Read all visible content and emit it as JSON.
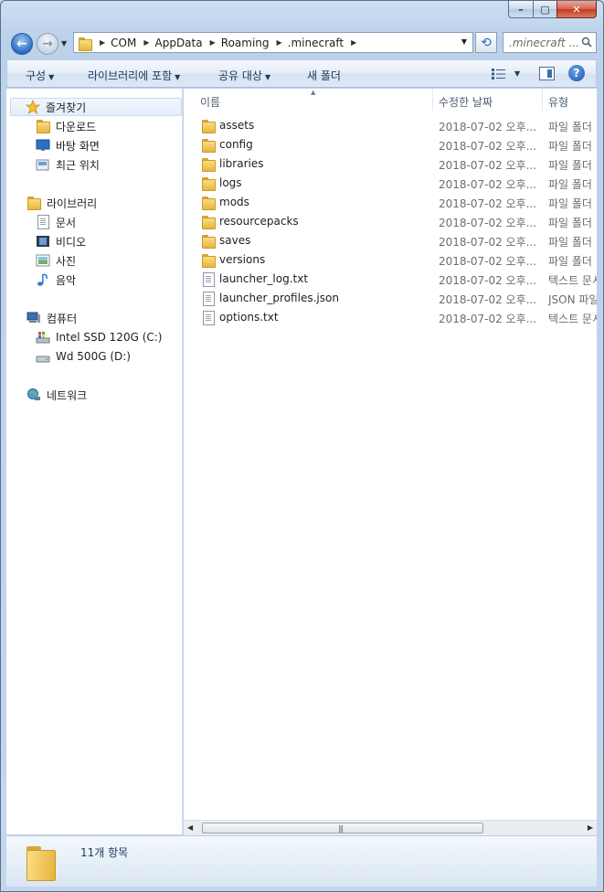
{
  "window": {
    "caption": {
      "minimize": "–",
      "maximize": "▢",
      "close": "✕"
    }
  },
  "address": {
    "crumbs": [
      "COM",
      "AppData",
      "Roaming",
      ".minecraft"
    ],
    "search_placeholder": ".minecraft ..."
  },
  "toolbar": {
    "organize": "구성",
    "include_library": "라이브러리에 포함",
    "share_with": "공유 대상",
    "new_folder": "새 폴더",
    "help": "?"
  },
  "nav": {
    "favorites": "즐겨찾기",
    "downloads": "다운로드",
    "desktop": "바탕 화면",
    "recent": "최근 위치",
    "libraries": "라이브러리",
    "documents": "문서",
    "videos": "비디오",
    "pictures": "사진",
    "music": "음악",
    "computer": "컴퓨터",
    "drive_c": "Intel SSD 120G (C:)",
    "drive_d": "Wd 500G (D:)",
    "network": "네트워크"
  },
  "columns": {
    "name": "이름",
    "date": "수정한 날짜",
    "type": "유형"
  },
  "files": [
    {
      "name": "assets",
      "date": "2018-07-02 오후...",
      "type": "파일 폴더",
      "kind": "folder"
    },
    {
      "name": "config",
      "date": "2018-07-02 오후...",
      "type": "파일 폴더",
      "kind": "folder"
    },
    {
      "name": "libraries",
      "date": "2018-07-02 오후...",
      "type": "파일 폴더",
      "kind": "folder"
    },
    {
      "name": "logs",
      "date": "2018-07-02 오후...",
      "type": "파일 폴더",
      "kind": "folder"
    },
    {
      "name": "mods",
      "date": "2018-07-02 오후...",
      "type": "파일 폴더",
      "kind": "folder"
    },
    {
      "name": "resourcepacks",
      "date": "2018-07-02 오후...",
      "type": "파일 폴더",
      "kind": "folder"
    },
    {
      "name": "saves",
      "date": "2018-07-02 오후...",
      "type": "파일 폴더",
      "kind": "folder"
    },
    {
      "name": "versions",
      "date": "2018-07-02 오후...",
      "type": "파일 폴더",
      "kind": "folder"
    },
    {
      "name": "launcher_log.txt",
      "date": "2018-07-02 오후...",
      "type": "텍스트 문서",
      "kind": "file"
    },
    {
      "name": "launcher_profiles.json",
      "date": "2018-07-02 오후...",
      "type": "JSON 파일",
      "kind": "file"
    },
    {
      "name": "options.txt",
      "date": "2018-07-02 오후...",
      "type": "텍스트 문서",
      "kind": "file"
    }
  ],
  "status": {
    "item_count": "11개 항목"
  }
}
